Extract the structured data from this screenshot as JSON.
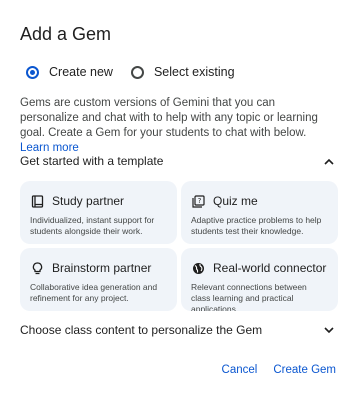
{
  "dialog": {
    "title": "Add a Gem",
    "radio_options": [
      {
        "label": "Create new",
        "checked": true
      },
      {
        "label": "Select existing",
        "checked": false
      }
    ],
    "description": "Gems are custom versions of Gemini that you can personalize and chat with to help with any topic or learning goal. Create a Gem for your students to chat with below.",
    "learn_more": "Learn more",
    "template_section": {
      "label": "Get started with a template",
      "expanded": true
    },
    "templates": [
      {
        "title": "Study partner",
        "icon": "book-icon",
        "description": "Individualized, instant support for students alongside their work."
      },
      {
        "title": "Quiz me",
        "icon": "quiz-icon",
        "description": "Adaptive practice problems to help students test their knowledge."
      },
      {
        "title": "Brainstorm partner",
        "icon": "lightbulb-icon",
        "description": "Collaborative idea generation and refinement for any project."
      },
      {
        "title": "Real-world connector",
        "icon": "globe-icon",
        "description": "Relevant connections between class learning and practical applications."
      }
    ],
    "class_content_section": {
      "label": "Choose class content to personalize the Gem",
      "expanded": false
    },
    "cancel_label": "Cancel",
    "create_label": "Create Gem"
  },
  "colors": {
    "accent": "#0b57d0",
    "card_bg": "#f0f4f9",
    "text": "#1f1f1f",
    "muted": "#444746"
  }
}
